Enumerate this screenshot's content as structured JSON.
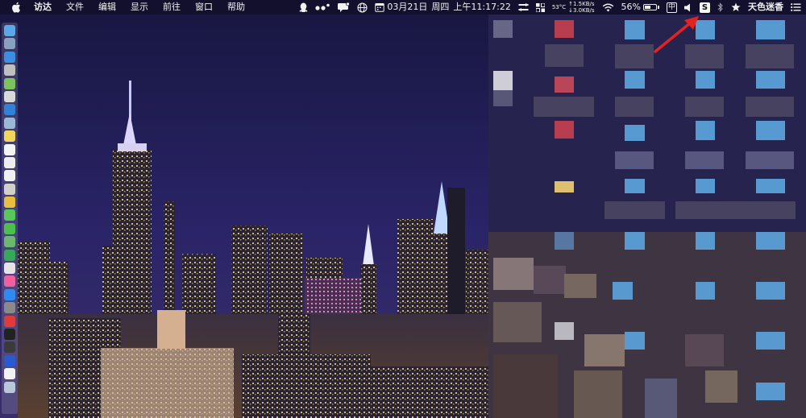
{
  "menubar": {
    "app_name": "访达",
    "menus": [
      "文件",
      "编辑",
      "显示",
      "前往",
      "窗口",
      "帮助"
    ],
    "date": "03月21日",
    "weekday": "周四",
    "time": "上午11:17:22",
    "temperature": "53°C",
    "net_up": "↑1.5KB/s",
    "net_down": "↓3.0KB/s",
    "battery_percent": "56%",
    "battery_level": 0.56,
    "input_method": "中",
    "s_app_label": "S",
    "username": "天色迷香"
  },
  "icons": {
    "apple": "apple-icon",
    "qq": "qq-icon",
    "wechat": "dots-icon",
    "notification": "message-icon",
    "globe": "globe-icon",
    "calendar": "calendar-icon",
    "sync": "sync-icon",
    "grid": "grid-icon",
    "wifi": "wifi-icon",
    "volume": "volume-icon",
    "bluetooth": "bluetooth-icon",
    "star": "star-icon",
    "list": "list-icon"
  },
  "dock": {
    "items": [
      {
        "name": "finder",
        "color": "#5aa8e8"
      },
      {
        "name": "launchpad",
        "color": "#8aa0c0"
      },
      {
        "name": "safari",
        "color": "#3d8ee0"
      },
      {
        "name": "rocket",
        "color": "#bfbfbf"
      },
      {
        "name": "android-tool",
        "color": "#7cc35c"
      },
      {
        "name": "disk-utility",
        "color": "#d8d8d8"
      },
      {
        "name": "app-store-blue",
        "color": "#2f82d8"
      },
      {
        "name": "preview",
        "color": "#9ab8d8"
      },
      {
        "name": "notes",
        "color": "#f2d65c"
      },
      {
        "name": "calendar",
        "color": "#f4f4f4"
      },
      {
        "name": "textedit",
        "color": "#eeeeee"
      },
      {
        "name": "reminders",
        "color": "#f0f0f0"
      },
      {
        "name": "photos-tool",
        "color": "#d0d0c8"
      },
      {
        "name": "chrome",
        "color": "#e8c040"
      },
      {
        "name": "messages",
        "color": "#59c85a"
      },
      {
        "name": "wechat",
        "color": "#4cc04c"
      },
      {
        "name": "maps",
        "color": "#6cb870"
      },
      {
        "name": "numbers",
        "color": "#36a858"
      },
      {
        "name": "itunes",
        "color": "#e4e4e4"
      },
      {
        "name": "music",
        "color": "#f060a0"
      },
      {
        "name": "app-store",
        "color": "#2d8cf0"
      },
      {
        "name": "system-prefs",
        "color": "#8a8a8a"
      },
      {
        "name": "vpn",
        "color": "#e03a3a"
      },
      {
        "name": "terminal",
        "color": "#222222"
      },
      {
        "name": "activity",
        "color": "#3a3a3a"
      },
      {
        "name": "vpn-plus",
        "color": "#2a5ad0"
      },
      {
        "name": "yandex",
        "color": "#f2f2f2"
      },
      {
        "name": "trash",
        "color": "#b8c8d8"
      }
    ]
  },
  "colors": {
    "sky": "#1d1a4a",
    "annotation_arrow": "#e52222"
  }
}
